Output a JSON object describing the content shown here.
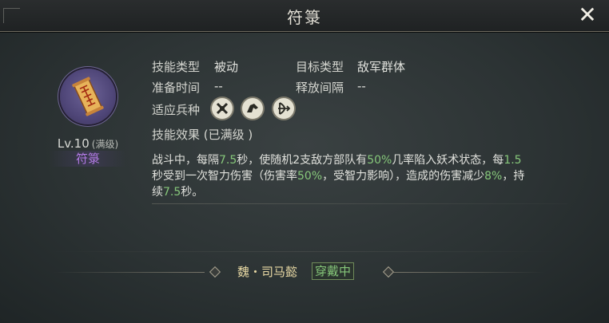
{
  "header": {
    "title": "符箓",
    "close_icon": "close-icon"
  },
  "skill": {
    "icon": "talisman-scroll-icon",
    "level": "Lv.10",
    "level_note": "(满级)",
    "name": "符箓",
    "name_color": "#b57be8"
  },
  "info": {
    "skill_type_label": "技能类型",
    "skill_type_value": "被动",
    "target_type_label": "目标类型",
    "target_type_value": "敌军群体",
    "prep_time_label": "准备时间",
    "prep_time_value": "--",
    "cast_interval_label": "释放间隔",
    "cast_interval_value": "--",
    "troop_label": "适应兵种",
    "troops": [
      "shield-troop-icon",
      "cavalry-troop-icon",
      "archer-troop-icon"
    ],
    "effect_label": "技能效果 (已满级 )"
  },
  "description": {
    "p1": "战斗中，每隔",
    "n1": "7.5",
    "p2": "秒，使随机2支敌方部队有",
    "n2": "50%",
    "p3": "几率陷入妖术状态，每",
    "n3": "1.5",
    "p4": "秒受到一次智力伤害（伤害率",
    "n4": "50%",
    "p5": "，受智力影响），造成的伤害减少",
    "n5": "8%",
    "p6": "，持续",
    "n6": "7.5",
    "p7": "秒。",
    "highlight_color": "#86c77a"
  },
  "footer": {
    "owner": "魏・司马懿",
    "status": "穿戴中"
  }
}
